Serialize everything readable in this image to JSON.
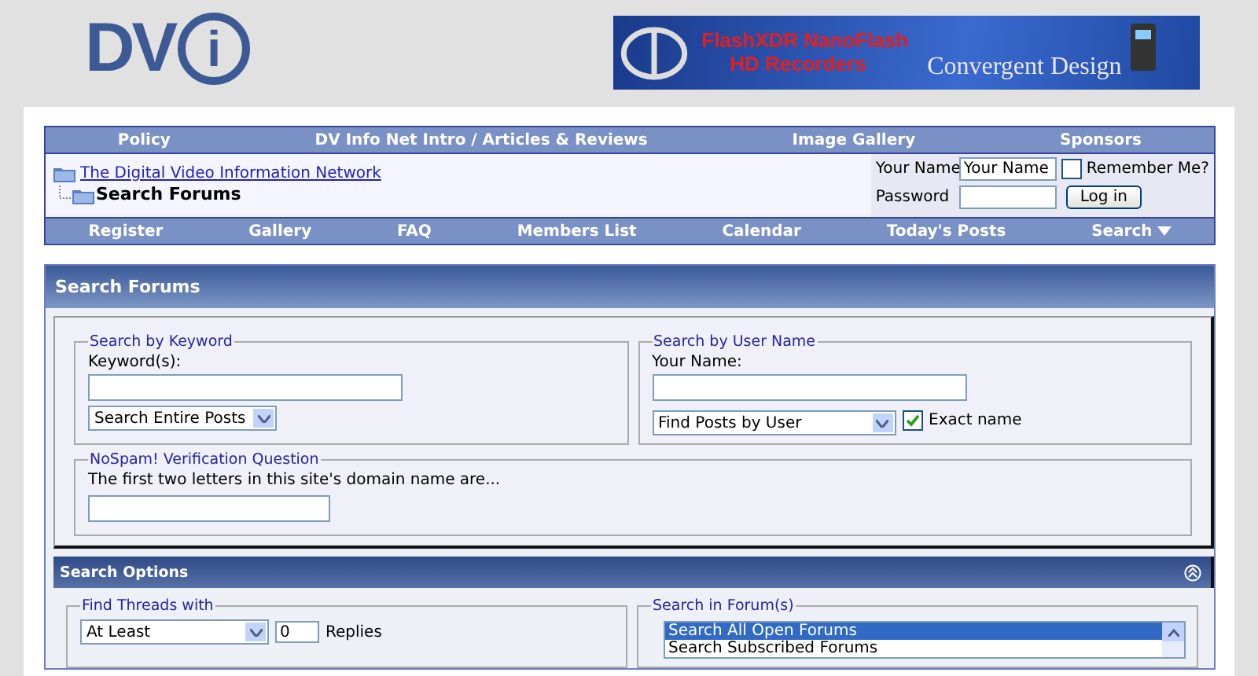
{
  "logo": {
    "letters": "DV",
    "circled": "i"
  },
  "banner": {
    "line_1": "FlashXDR NanoFlash",
    "line_2": "HD Recorders",
    "brand": "Convergent Design"
  },
  "top_nav": [
    "Policy",
    "DV Info Net Intro / Articles & Reviews",
    "Image Gallery",
    "Sponsors"
  ],
  "breadcrumb": {
    "parent": "The Digital Video Information Network",
    "current": "Search Forums"
  },
  "login": {
    "name_label": "Your Name",
    "name_value": "Your Name",
    "remember_label": "Remember Me?",
    "remember_checked": false,
    "password_label": "Password",
    "button": "Log in"
  },
  "bottom_nav": [
    {
      "label": "Register",
      "menu": false
    },
    {
      "label": "Gallery",
      "menu": false
    },
    {
      "label": "FAQ",
      "menu": false
    },
    {
      "label": "Members List",
      "menu": false
    },
    {
      "label": "Calendar",
      "menu": false
    },
    {
      "label": "Today's Posts",
      "menu": false
    },
    {
      "label": "Search",
      "menu": true
    }
  ],
  "search_panel": {
    "title": "Search Forums",
    "keyword": {
      "legend": "Search by Keyword",
      "label": "Keyword(s):",
      "select": "Search Entire Posts"
    },
    "user": {
      "legend": "Search by User Name",
      "label": "Your Name:",
      "select": "Find Posts by User",
      "exact_label": "Exact name",
      "exact_checked": true
    },
    "nospam": {
      "legend": "NoSpam! Verification Question",
      "question": "The first two letters in this site's domain name are..."
    }
  },
  "options_panel": {
    "title": "Search Options",
    "expanded": true,
    "threads": {
      "legend": "Find Threads with",
      "select": "At Least",
      "count": "0",
      "unit": "Replies"
    },
    "forums": {
      "legend": "Search in Forum(s)",
      "items": [
        {
          "label": "Search All Open Forums",
          "selected": true
        },
        {
          "label": "Search Subscribed Forums",
          "selected": false
        }
      ]
    }
  }
}
